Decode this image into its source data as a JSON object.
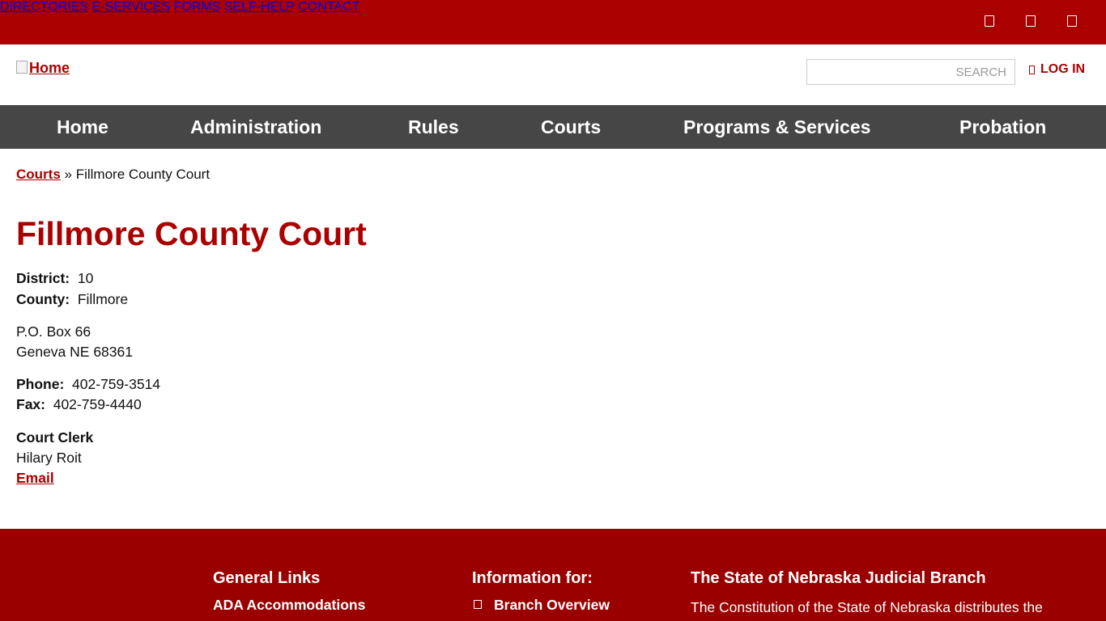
{
  "top_nav": {
    "items": [
      "DIRECTORIES",
      "E-SERVICES",
      "FORMS",
      "SELF-HELP",
      "CONTACT"
    ],
    "icons": [
      "facebook-icon",
      "twitter-icon",
      "youtube-icon"
    ]
  },
  "header": {
    "logo_alt": "Home",
    "search_placeholder": "SEARCH",
    "login_label": "LOG IN"
  },
  "main_nav": {
    "items": [
      "Home",
      "Administration",
      "Rules",
      "Courts",
      "Programs & Services",
      "Probation"
    ]
  },
  "breadcrumb": {
    "parent": "Courts",
    "separator": "»",
    "current": "Fillmore County Court"
  },
  "court": {
    "title": "Fillmore County Court",
    "district_label": "District:",
    "district": "10",
    "county_label": "County:",
    "county": "Fillmore",
    "address_line1": "P.O. Box 66",
    "address_line2": "Geneva NE 68361",
    "phone_label": "Phone:",
    "phone": "402-759-3514",
    "fax_label": "Fax:",
    "fax": "402-759-4440",
    "clerk_heading": "Court Clerk",
    "clerk_name": "Hilary Roit",
    "email_label": "Email"
  },
  "footer": {
    "general_links_heading": "General Links",
    "general_links": [
      "ADA Accommodations"
    ],
    "information_heading": "Information for:",
    "information_links": [
      "Branch Overview"
    ],
    "branch_heading": "The State of Nebraska Judicial Branch",
    "branch_text": "The Constitution of the State of Nebraska distributes the"
  },
  "colors": {
    "brand_red": "#ab0000",
    "footer_red": "#9a0000",
    "nav_gray": "#464646"
  }
}
